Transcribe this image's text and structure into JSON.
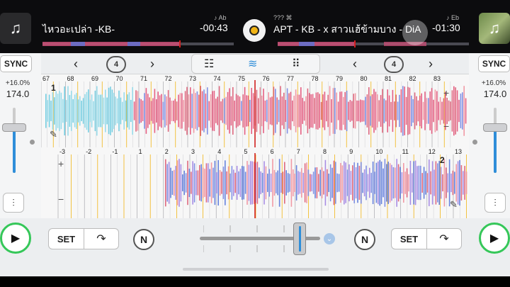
{
  "deck_left": {
    "track_title": "ไหวอะเปล่า -KB-",
    "key": "Ab",
    "time_remaining": "-00:43",
    "sync_label": "SYNC",
    "pitch_percent": "+16.0%",
    "bpm": "174.0",
    "pitch_level": 0.7,
    "icon": "music-note-icon"
  },
  "deck_right": {
    "track_title": "APT - KB - x สาวแฮ้ข้ามบาง - DiA",
    "meta_prefix": "???",
    "key": "Eb",
    "time_remaining": "-01:30",
    "sync_label": "SYNC",
    "pitch_percent": "+16.0%",
    "bpm": "174.0",
    "pitch_level": 0.7,
    "icon": "music-note-icon"
  },
  "controls": {
    "loop_left": "4",
    "loop_right": "4",
    "set_label": "SET",
    "n_label": "N",
    "crossfader_position": 0.88
  },
  "waveform_top": {
    "cue_marker": "1",
    "beat_numbers": [
      "67",
      "68",
      "69",
      "70",
      "71",
      "72",
      "73",
      "74",
      "75",
      "76",
      "77",
      "78",
      "79",
      "80",
      "81",
      "82",
      "83"
    ]
  },
  "waveform_bottom": {
    "cue_marker": "2",
    "beat_numbers": [
      "-3",
      "-2",
      "-1",
      "1",
      "2",
      "3",
      "4",
      "5",
      "6",
      "7",
      "8",
      "9",
      "10",
      "11",
      "12",
      "13"
    ]
  },
  "colors": {
    "accent_blue": "#2f8ed9",
    "play_green": "#35c759",
    "record_yellow": "#f1b414",
    "playhead_red": "#d12020"
  }
}
